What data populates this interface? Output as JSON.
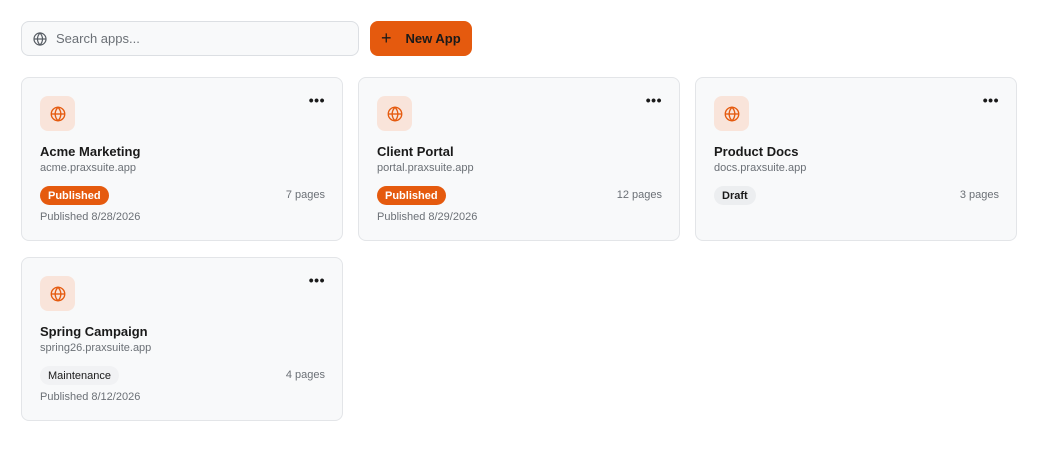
{
  "search": {
    "placeholder": "Search apps...",
    "icon": "globe-icon"
  },
  "new_app": {
    "label": "New App",
    "icon": "plus-icon"
  },
  "accent": "#e55a0e",
  "apps": [
    {
      "name": "Acme Marketing",
      "domain": "acme.praxsuite.app",
      "status": "Published",
      "pages": "7 pages",
      "date": "Published 8/28/2026"
    },
    {
      "name": "Client Portal",
      "domain": "portal.praxsuite.app",
      "status": "Published",
      "pages": "12 pages",
      "date": "Published 8/29/2026"
    },
    {
      "name": "Product Docs",
      "domain": "docs.praxsuite.app",
      "status": "Draft",
      "pages": "3 pages",
      "date": ""
    },
    {
      "name": "Spring Campaign",
      "domain": "spring26.praxsuite.app",
      "status": "Maintenance",
      "pages": "4 pages",
      "date": "Published 8/12/2026"
    }
  ]
}
